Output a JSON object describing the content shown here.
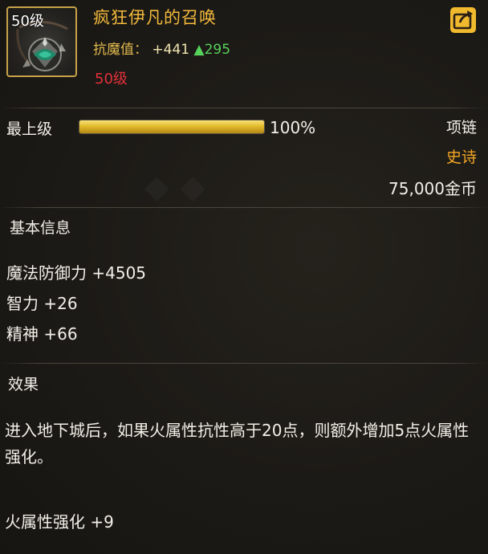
{
  "item": {
    "level_badge": "50级",
    "name": "疯狂伊凡的召唤",
    "resist_label": "抗魔值：",
    "resist_value": "+441",
    "resist_delta": "▲295",
    "required_level": "50级"
  },
  "grade": {
    "label": "最上级",
    "progress": 1.0,
    "percent_text": "100%"
  },
  "meta": {
    "slot": "项链",
    "rarity": "史诗",
    "price": "75,000金币"
  },
  "basic_info": {
    "header": "基本信息",
    "stats": [
      "魔法防御力 +4505",
      "智力 +26",
      "精神 +66"
    ]
  },
  "effect": {
    "header": "效果",
    "description": "进入地下城后，如果火属性抗性高于20点，则额外增加5点火属性强化。",
    "bonus": "火属性强化 +9"
  },
  "icons": {
    "item_icon": "amulet-icon",
    "share": "share-icon"
  },
  "colors": {
    "title": "#f2b93b",
    "rarity": "#f5a623",
    "required_level": "#e2303a",
    "delta_up": "#56d15a",
    "frame": "#c8a24a"
  }
}
